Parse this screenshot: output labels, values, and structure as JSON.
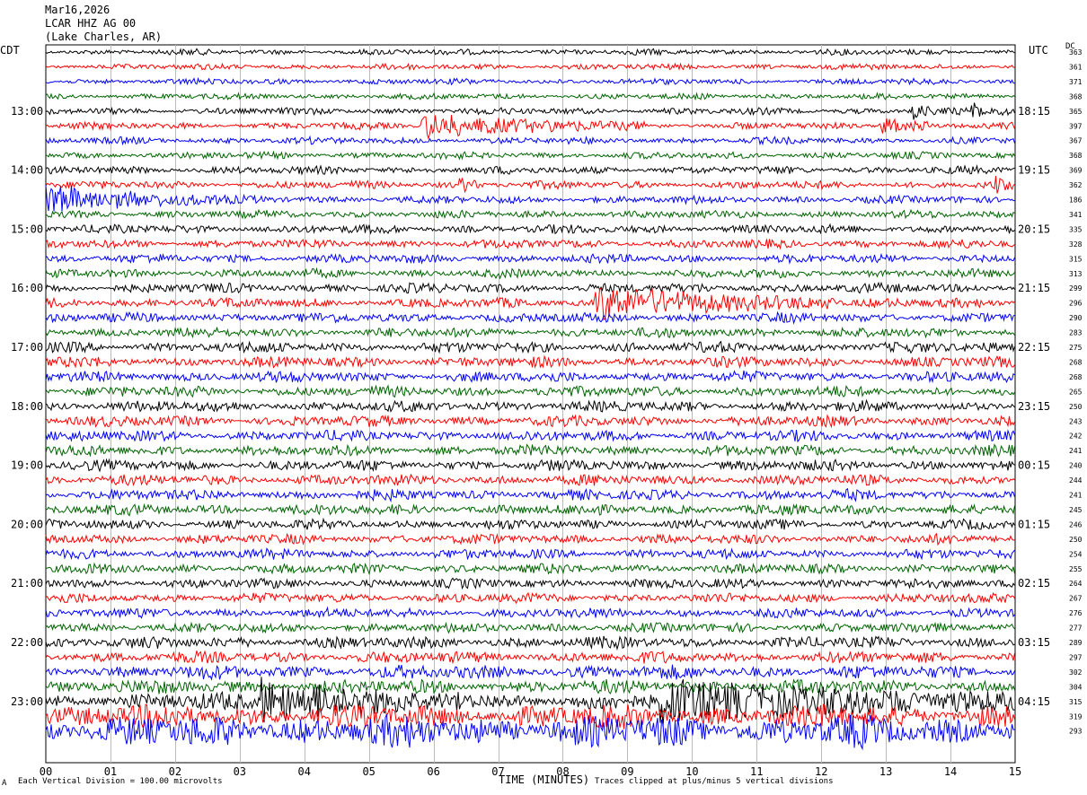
{
  "header": {
    "date": "Mar16,2026",
    "station": "LCAR HHZ AG 00",
    "location": "(Lake Charles, AR)"
  },
  "left_zone": "CDT",
  "right_zone": "UTC",
  "dc_label": "DC",
  "footer": {
    "scale_note": "Each Vertical Division = 100.00 microvolts",
    "xlabel": "TIME (MINUTES)",
    "clip_note": "Traces clipped at plus/minus 5 vertical divisions",
    "corner_mark": "A"
  },
  "trace_colors": [
    "#000000",
    "#ff0000",
    "#0000ff",
    "#006400"
  ],
  "chart_data": {
    "type": "helicorder",
    "xlabel": "TIME (MINUTES)",
    "xlim": [
      0,
      15
    ],
    "x_ticks": [
      "00",
      "01",
      "02",
      "03",
      "04",
      "05",
      "06",
      "07",
      "08",
      "09",
      "10",
      "11",
      "12",
      "13",
      "14",
      "15"
    ],
    "lines_per_hour": 4,
    "num_lines": 44,
    "left_hour_labels": [
      "13:00",
      "14:00",
      "15:00",
      "16:00",
      "17:00",
      "18:00",
      "19:00",
      "20:00",
      "21:00",
      "22:00",
      "23:00"
    ],
    "right_hour_labels": [
      "18:15",
      "19:15",
      "20:15",
      "21:15",
      "22:15",
      "23:15",
      "00:15",
      "01:15",
      "02:15",
      "03:15",
      "04:15"
    ],
    "dc_values": [
      363,
      361,
      371,
      368,
      365,
      397,
      367,
      368,
      369,
      362,
      186,
      341,
      335,
      328,
      315,
      313,
      299,
      296,
      290,
      283,
      275,
      268,
      268,
      265,
      250,
      243,
      242,
      241,
      240,
      244,
      241,
      245,
      246,
      250,
      254,
      255,
      264,
      267,
      276,
      277,
      289,
      297,
      302,
      304,
      315,
      319,
      293
    ],
    "base_amplitude": [
      3,
      3,
      3,
      3,
      3.5,
      3.5,
      3.5,
      3.5,
      4,
      4,
      4,
      4,
      4.5,
      4.5,
      4.5,
      4.5,
      5,
      5,
      5,
      5,
      5.5,
      5.5,
      5.5,
      5.5,
      5.5,
      5.5,
      5.5,
      5.5,
      5.5,
      5.5,
      5.5,
      5.5,
      5,
      5,
      5,
      5,
      5,
      5,
      5,
      5,
      6,
      6,
      7,
      7,
      9,
      12,
      16
    ],
    "events": [
      {
        "line": 4,
        "start_min": 13.4,
        "end_min": 13.9,
        "amplitude": 10
      },
      {
        "line": 4,
        "start_min": 14.3,
        "end_min": 14.9,
        "amplitude": 10
      },
      {
        "line": 5,
        "start_min": 5.8,
        "end_min": 9.3,
        "amplitude": 14
      },
      {
        "line": 5,
        "start_min": 12.9,
        "end_min": 13.8,
        "amplitude": 10
      },
      {
        "line": 9,
        "start_min": 6.4,
        "end_min": 6.7,
        "amplitude": 9
      },
      {
        "line": 9,
        "start_min": 14.7,
        "end_min": 15.0,
        "amplitude": 8
      },
      {
        "line": 10,
        "start_min": 0.0,
        "end_min": 2.8,
        "amplitude": 16
      },
      {
        "line": 17,
        "start_min": 8.5,
        "end_min": 12.2,
        "amplitude": 20
      },
      {
        "line": 44,
        "start_min": 3.3,
        "end_min": 6.5,
        "amplitude": 22
      },
      {
        "line": 44,
        "start_min": 9.5,
        "end_min": 15.0,
        "amplitude": 22
      }
    ]
  }
}
